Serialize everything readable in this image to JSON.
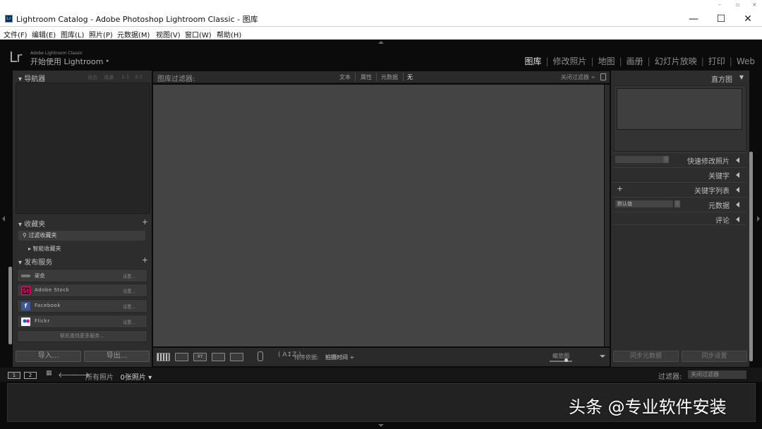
{
  "window": {
    "title": "Lightroom Catalog - Adobe Photoshop Lightroom Classic - 图库",
    "app_icon": "Lr",
    "controls": {
      "minimize": "—",
      "maximize": "☐",
      "close": "✕"
    }
  },
  "menu": [
    "文件(F)",
    "编辑(E)",
    "图库(L)",
    "照片(P)",
    "元数据(M)",
    "视图(V)",
    "窗口(W)",
    "帮助(H)"
  ],
  "identity": {
    "logo": "Lr",
    "product": "Adobe Lightroom Classic",
    "start": "开始使用 Lightroom",
    "start_arrow": "▸"
  },
  "modules": {
    "items": [
      "图库",
      "修改照片",
      "地图",
      "画册",
      "幻灯片放映",
      "打印",
      "Web"
    ],
    "active": "图库",
    "separator": "|"
  },
  "left": {
    "navigator": {
      "label": "▾ 导航器",
      "zoom": [
        "适合",
        "填满",
        "1:1",
        "3:1"
      ]
    },
    "collections": {
      "label": "▾ 收藏夹",
      "add": "+",
      "filter": "过滤收藏夹",
      "smart": "▸   智能收藏夹"
    },
    "publish": {
      "label": "▾ 发布服务",
      "add": "+",
      "items": [
        {
          "name": "硬盘",
          "setup": "设置...",
          "icon": "hard-drive-icon"
        },
        {
          "name": "Adobe Stock",
          "setup": "设置...",
          "icon": "adobe-stock-icon",
          "badge": "St",
          "color": "#e8127c"
        },
        {
          "name": "Facebook",
          "setup": "设置...",
          "icon": "facebook-icon",
          "badge": "f",
          "color": "#3b5998"
        },
        {
          "name": "Flickr",
          "setup": "设置...",
          "icon": "flickr-icon"
        }
      ],
      "more": "联机查找更多服务..."
    },
    "import": "导入...",
    "export": "导出..."
  },
  "filter_bar": {
    "label": "图库过滤器:",
    "tabs": [
      "文本",
      "属性",
      "元数据",
      "无"
    ],
    "active": "无",
    "close": "关闭过滤器 ÷"
  },
  "toolbar": {
    "views": [
      "grid-view-icon",
      "loupe-view-icon",
      "compare-view-icon",
      "survey-view-icon",
      "people-view-icon"
    ],
    "view_labels": [
      "",
      "",
      "XY",
      "",
      ""
    ],
    "sort_icon": "( A↕Z )",
    "sort_label": "排序依据:",
    "sort_value": "拍摄时间 ÷",
    "thumbnails_label": "缩览图"
  },
  "right": {
    "histogram": "直方图",
    "quick_develop": "快速修改照片",
    "keywording": "关键字",
    "keyword_list": "关键字列表",
    "keyword_add": "+",
    "metadata": "元数据",
    "metadata_preset": "默认值",
    "comments": "评论",
    "sync_metadata": "同步元数据",
    "sync_settings": "同步设置"
  },
  "filmstrip": {
    "monitor1": "1",
    "monitor2": "2",
    "source": "所有照片",
    "count": "0张照片 ▾",
    "filter_label": "过滤器:",
    "filter_value": "关闭过滤器"
  },
  "watermark": "头条 @专业软件安装"
}
